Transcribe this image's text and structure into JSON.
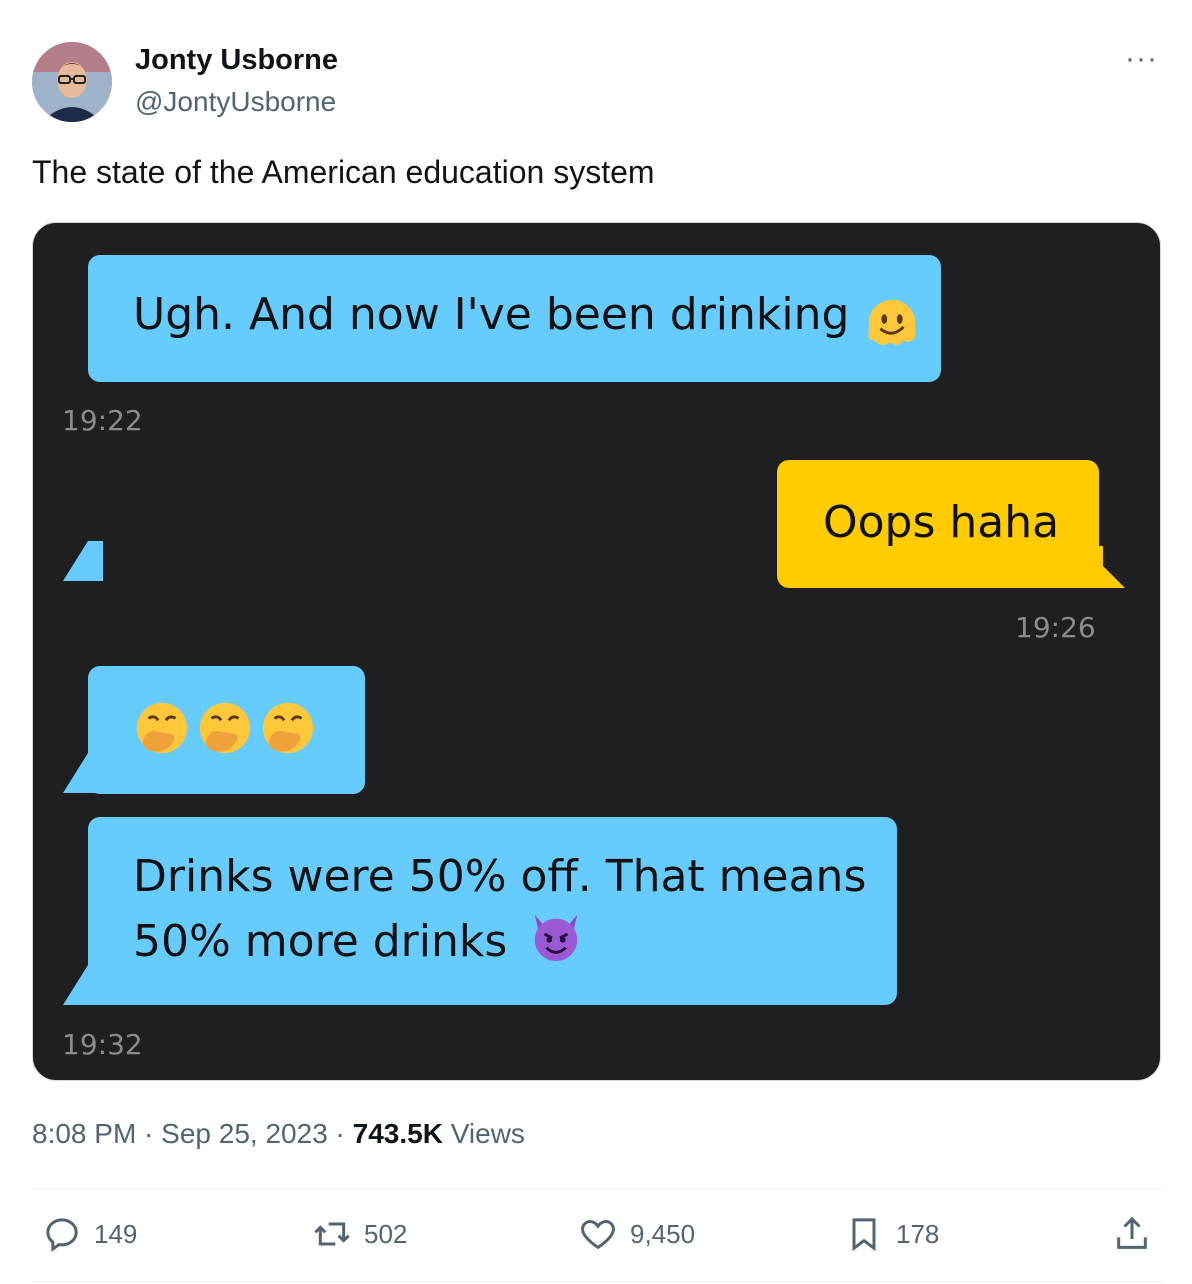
{
  "author": {
    "name": "Jonty Usborne",
    "handle": "@JontyUsborne"
  },
  "more_label": "···",
  "tweet_text": "The state of the American education system",
  "chat": {
    "messages": [
      {
        "side": "left",
        "text": "Ugh. And now I've been drinking",
        "emoji": "melting-face",
        "time": "19:22"
      },
      {
        "side": "right",
        "text": "Oops haha",
        "time": "19:26"
      },
      {
        "side": "left",
        "text": "",
        "emoji": "face-with-hand-over-mouth x3",
        "time": ""
      },
      {
        "side": "left",
        "text_line1": "Drinks were 50% off. That means",
        "text_line2": "50% more drinks",
        "emoji": "smiling-face-with-horns",
        "time": "19:32"
      }
    ],
    "colors": {
      "background": "#1f1f21",
      "incoming": "#66ccfe",
      "outgoing": "#ffcc00"
    }
  },
  "meta": {
    "time": "8:08 PM",
    "sep1": " · ",
    "date": "Sep 25, 2023",
    "sep2": " · ",
    "views_count": "743.5K",
    "views_label": " Views"
  },
  "actions": {
    "replies": "149",
    "reposts": "502",
    "likes": "9,450",
    "bookmarks": "178"
  }
}
